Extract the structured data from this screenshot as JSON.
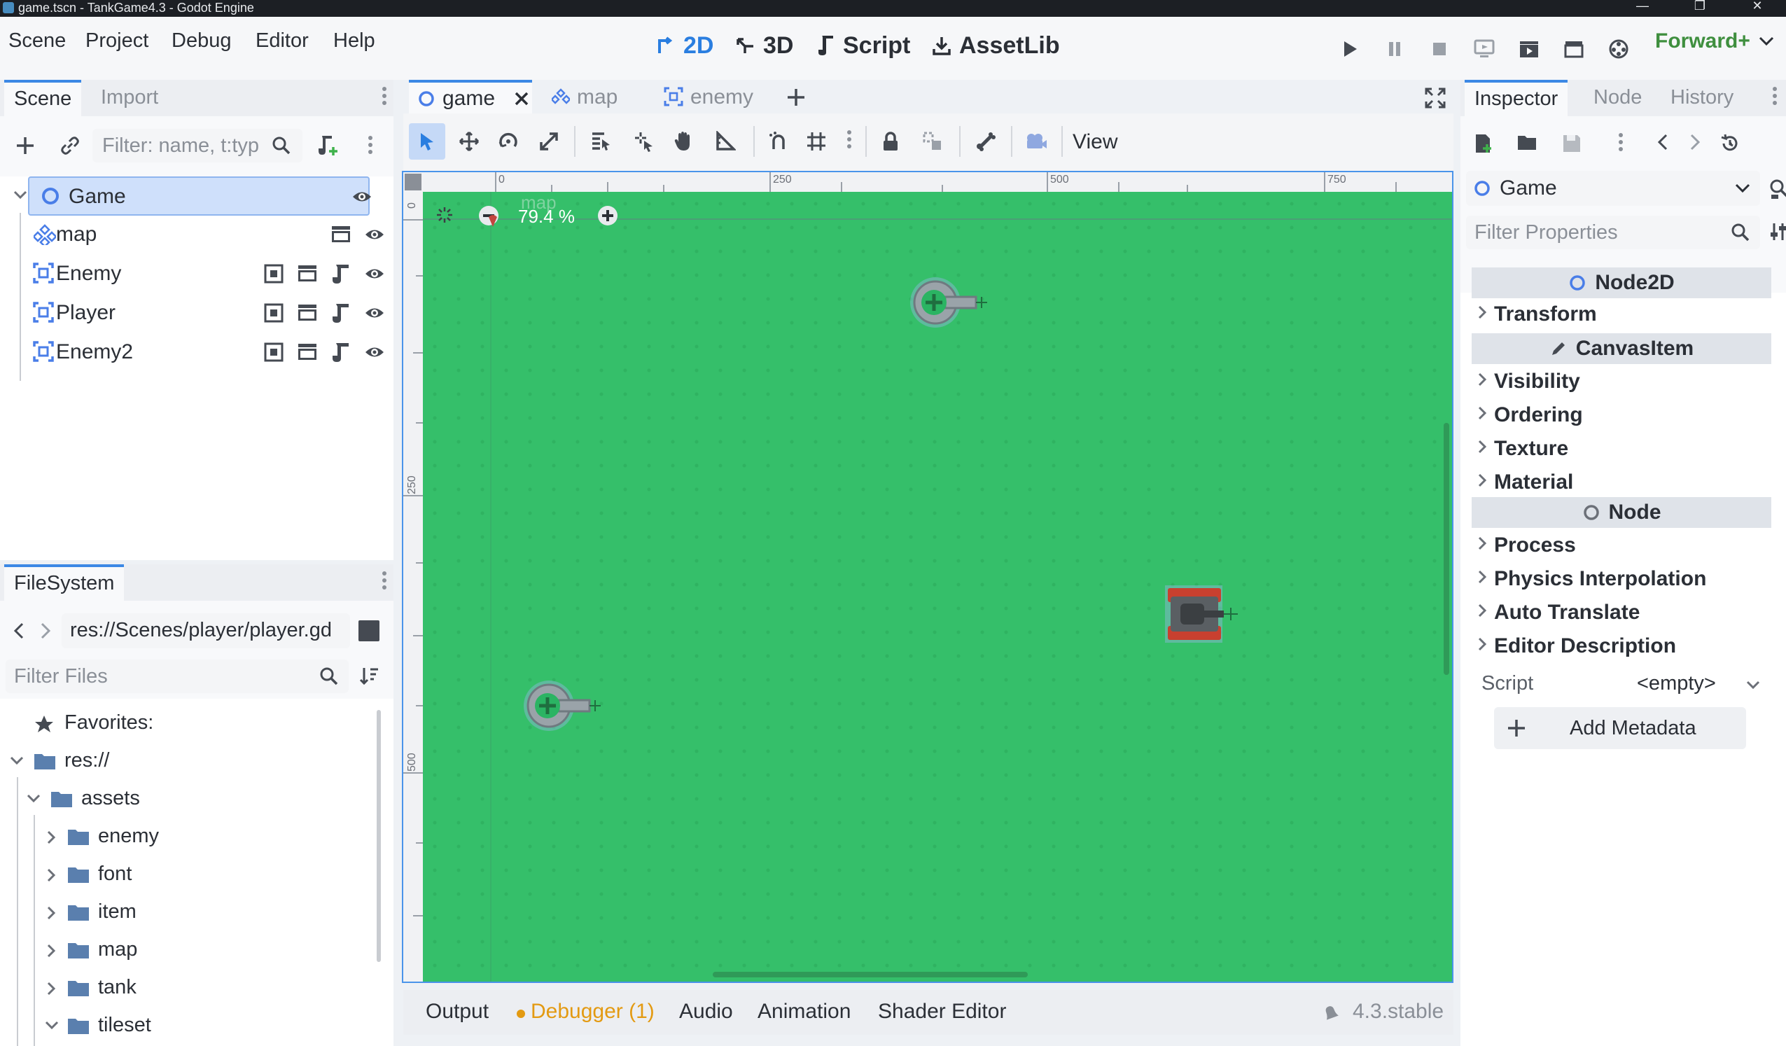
{
  "window": {
    "title": "game.tscn - TankGame4.3 - Godot Engine",
    "controls": [
      "—",
      "❐",
      "✕"
    ]
  },
  "menu": [
    "Scene",
    "Project",
    "Debug",
    "Editor",
    "Help"
  ],
  "workspaces": [
    {
      "label": "2D",
      "active": true
    },
    {
      "label": "3D",
      "active": false
    },
    {
      "label": "Script",
      "active": false
    },
    {
      "label": "AssetLib",
      "active": false
    }
  ],
  "renderer": "Forward+",
  "scene_dock": {
    "tabs": [
      "Scene",
      "Import"
    ],
    "filter_placeholder": "Filter: name, t:typ",
    "tree": [
      {
        "label": "Game",
        "icon": "node2d-icon",
        "selected": true
      },
      {
        "label": "map",
        "icon": "tilemap-icon"
      },
      {
        "label": "Enemy",
        "icon": "instance-icon"
      },
      {
        "label": "Player",
        "icon": "instance-icon"
      },
      {
        "label": "Enemy2",
        "icon": "instance-icon"
      }
    ]
  },
  "filesystem": {
    "tab": "FileSystem",
    "path": "res://Scenes/player/player.gd",
    "filter_placeholder": "Filter Files",
    "items": [
      {
        "label": "Favorites:",
        "depth": 0,
        "icon": "star-icon"
      },
      {
        "label": "res://",
        "depth": 0,
        "icon": "folder-icon",
        "expanded": true
      },
      {
        "label": "assets",
        "depth": 1,
        "icon": "folder-icon",
        "expanded": true
      },
      {
        "label": "enemy",
        "depth": 2,
        "icon": "folder-icon"
      },
      {
        "label": "font",
        "depth": 2,
        "icon": "folder-icon"
      },
      {
        "label": "item",
        "depth": 2,
        "icon": "folder-icon"
      },
      {
        "label": "map",
        "depth": 2,
        "icon": "folder-icon"
      },
      {
        "label": "tank",
        "depth": 2,
        "icon": "folder-icon"
      },
      {
        "label": "tileset",
        "depth": 2,
        "icon": "folder-icon",
        "expanded": true
      }
    ]
  },
  "editor_tabs": [
    {
      "label": "game",
      "active": true,
      "closable": true
    },
    {
      "label": "map",
      "active": false
    },
    {
      "label": "enemy",
      "active": false
    }
  ],
  "viewport": {
    "view_menu": "View",
    "zoom": "79.4 %",
    "node_label": "map",
    "ruler_top": [
      "0",
      "250",
      "500",
      "750"
    ],
    "ruler_left": [
      "0",
      "250",
      "500"
    ]
  },
  "bottom_panel": {
    "tabs": [
      "Output",
      "Debugger (1)",
      "Audio",
      "Animation",
      "Shader Editor"
    ],
    "version": "4.3.stable"
  },
  "inspector": {
    "tabs": [
      "Inspector",
      "Node",
      "History"
    ],
    "object": "Game",
    "filter_placeholder": "Filter Properties",
    "classes": [
      {
        "header": "Node2D",
        "sections": [
          "Transform"
        ]
      },
      {
        "header": "CanvasItem",
        "sections": [
          "Visibility",
          "Ordering",
          "Texture",
          "Material"
        ]
      },
      {
        "header": "Node",
        "sections": [
          "Process",
          "Physics Interpolation",
          "Auto Translate",
          "Editor Description"
        ]
      }
    ],
    "script_label": "Script",
    "script_value": "<empty>",
    "add_metadata": "Add Metadata"
  },
  "colors": {
    "accent": "#3c88e5",
    "canvas": "#35bf6a",
    "debugger_warning": "#e39a12",
    "renderer": "#3f8f3f"
  }
}
